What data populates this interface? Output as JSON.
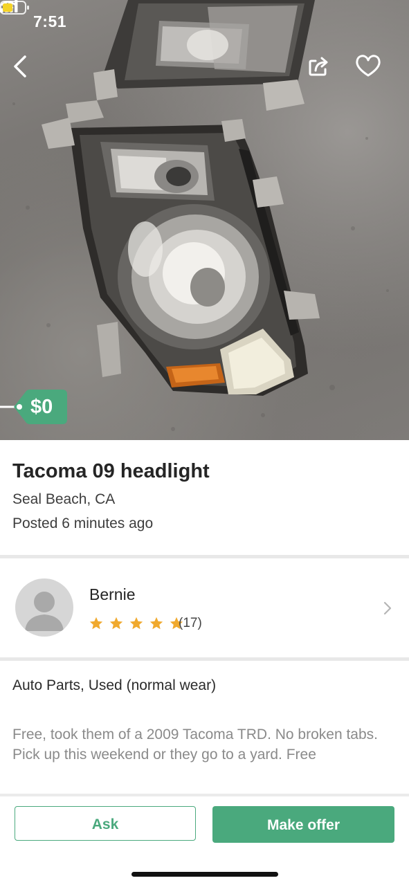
{
  "status_bar": {
    "time": "7:51"
  },
  "listing": {
    "price": "$0",
    "title": "Tacoma 09 headlight",
    "location": "Seal Beach, CA",
    "posted": "Posted 6 minutes ago",
    "category": "Auto Parts, Used (normal wear)",
    "description": "Free, took them of a 2009 Tacoma TRD. No broken tabs. Pick up this weekend or they go to a yard. Free"
  },
  "seller": {
    "name": "Bernie",
    "rating_count": "(17)",
    "stars": 5
  },
  "actions": {
    "ask_label": "Ask",
    "offer_label": "Make offer"
  },
  "icons": {
    "back": "chevron-left-icon",
    "share": "share-icon",
    "favorite": "heart-icon",
    "seller_chevron": "chevron-right-icon"
  },
  "colors": {
    "accent": "#4aa97d",
    "star": "#f0a92e",
    "price_tag": "#4aa97d"
  }
}
